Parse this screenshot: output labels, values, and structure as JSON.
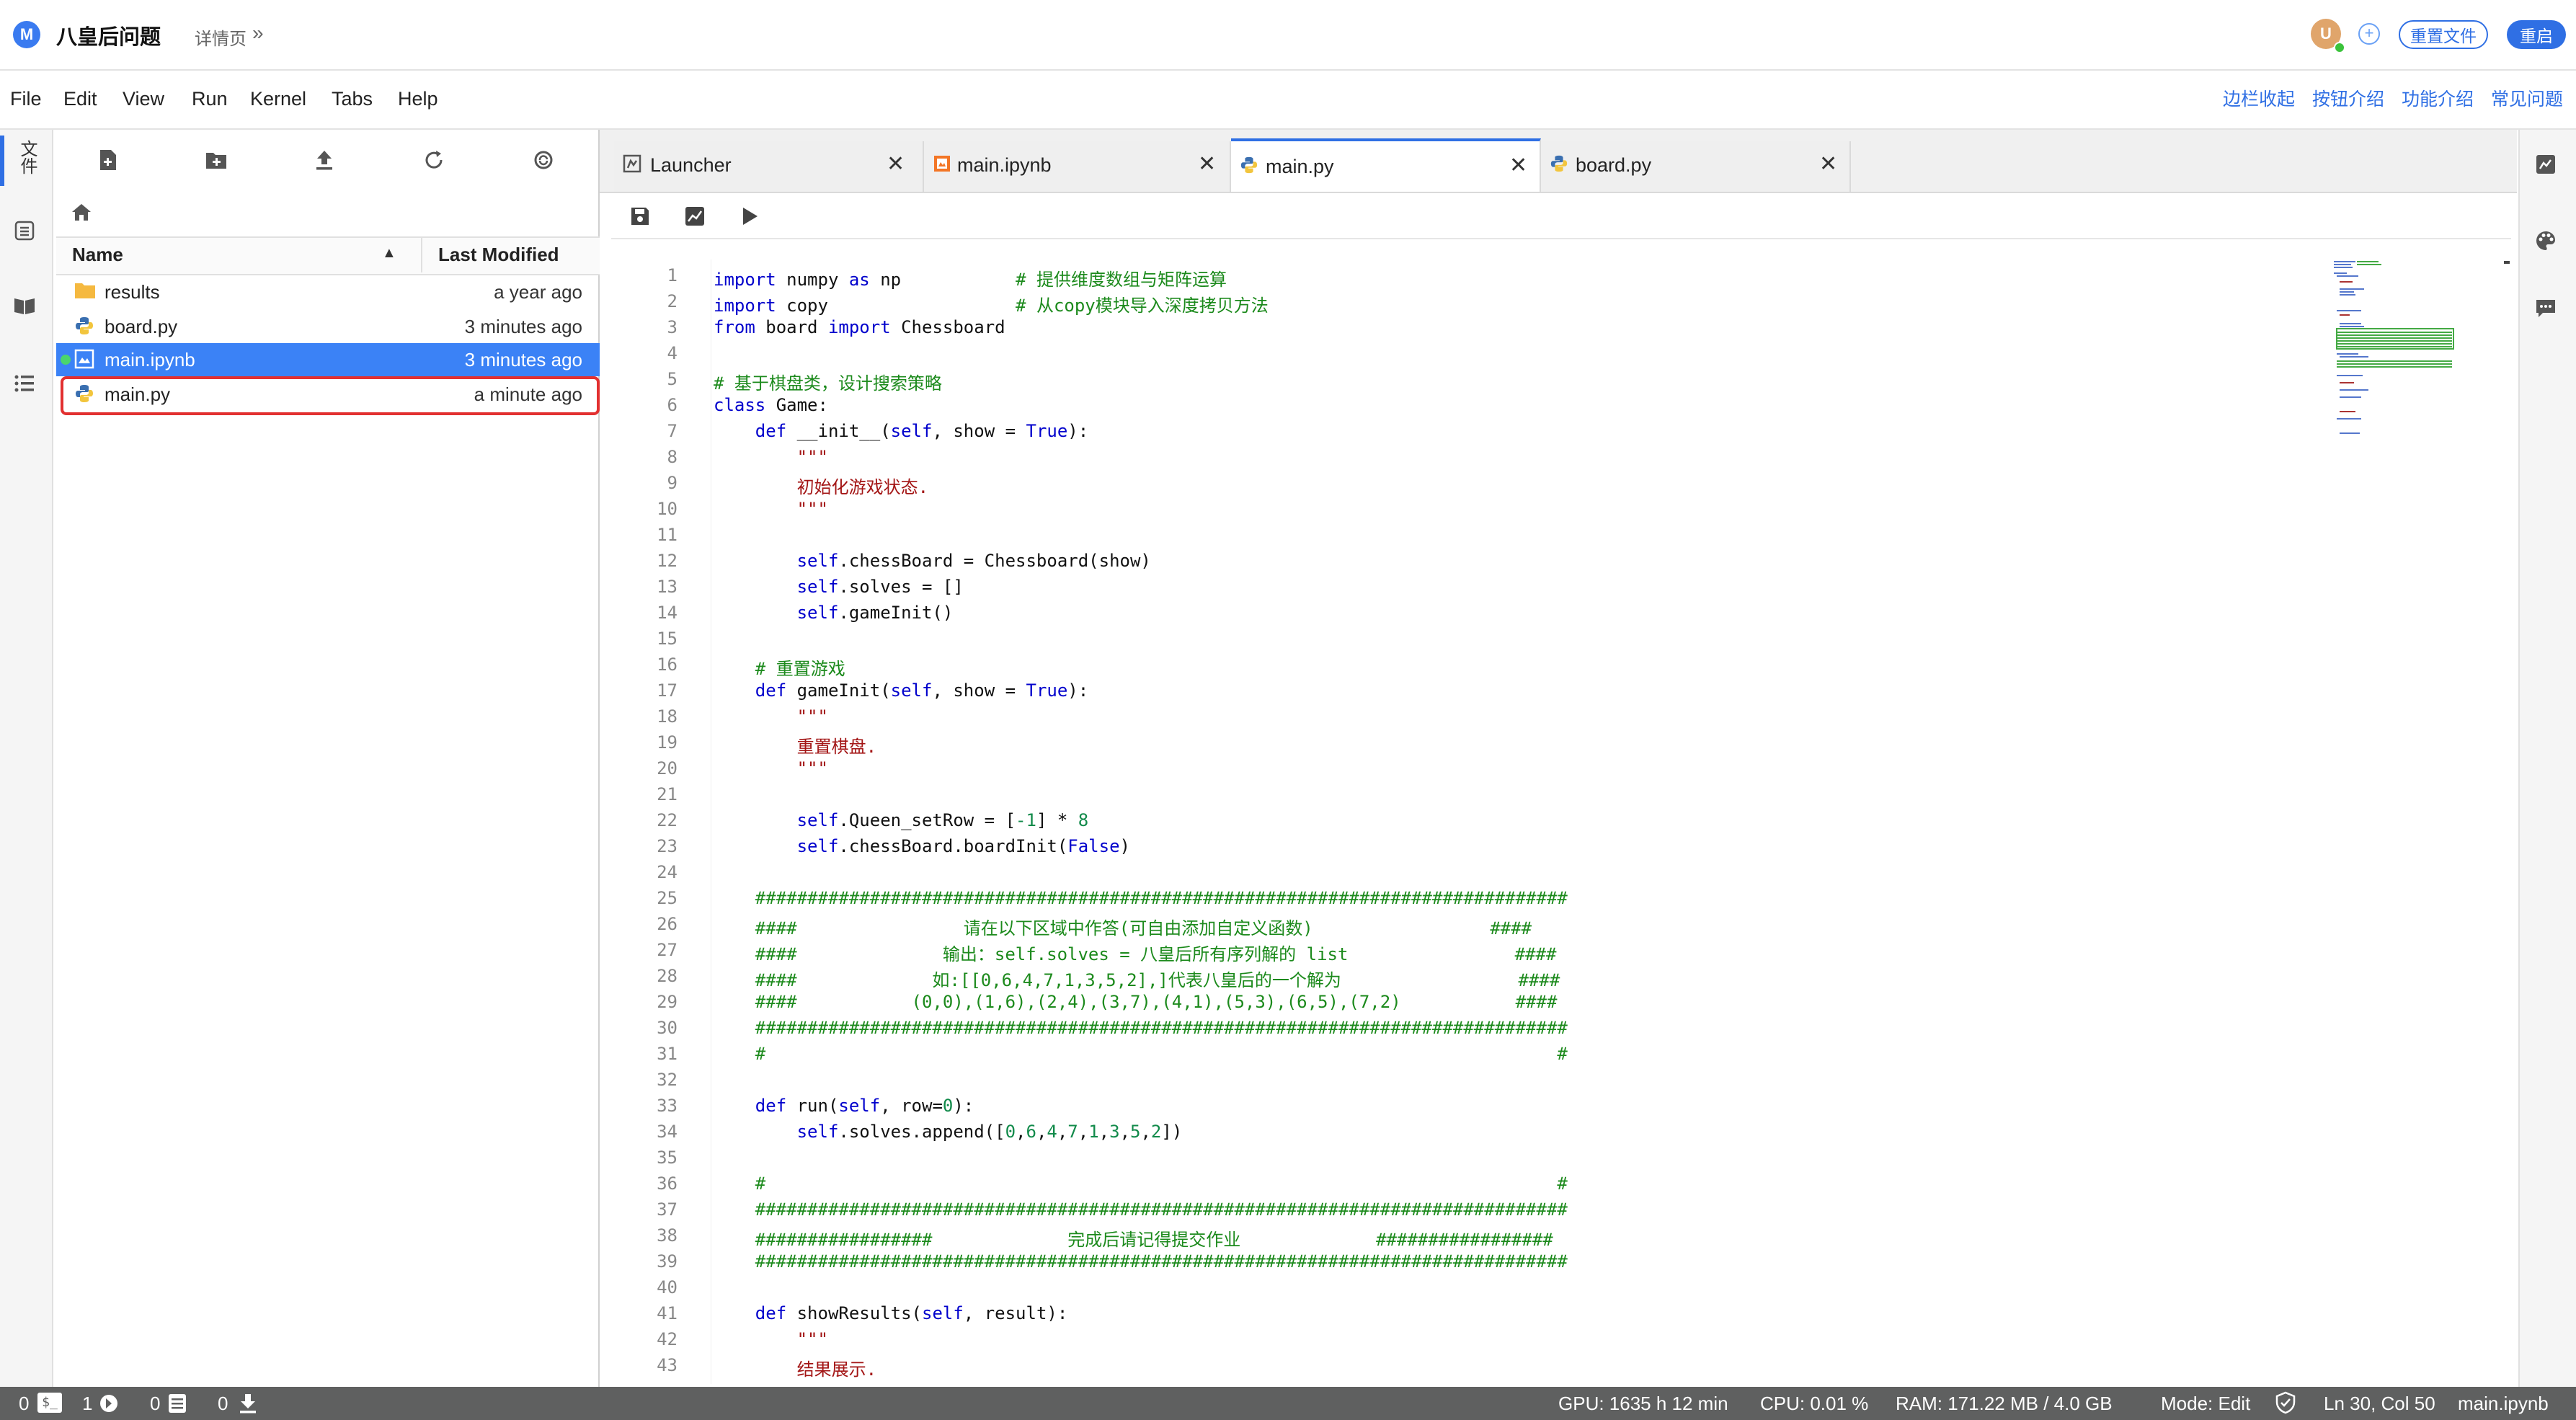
{
  "app": {
    "logo_letter": "M",
    "title": "八皇后问题",
    "breadcrumb": "详情页",
    "breadcrumb_chevron": "»",
    "avatar_letter": "U",
    "reset_button": "重置文件",
    "restart_button": "重启"
  },
  "menu": {
    "items": [
      "File",
      "Edit",
      "View",
      "Run",
      "Kernel",
      "Tabs",
      "Help"
    ],
    "right_links": [
      "边栏收起",
      "按钮介绍",
      "功能介绍",
      "常见问题"
    ]
  },
  "left_strip": {
    "items": [
      {
        "label": "文件",
        "icon": "folder-icon"
      },
      {
        "label": "",
        "icon": "running-icon"
      },
      {
        "label": "",
        "icon": "book-icon"
      },
      {
        "label": "",
        "icon": "toc-icon"
      }
    ]
  },
  "file_browser": {
    "columns": {
      "name": "Name",
      "modified": "Last Modified"
    },
    "rows": [
      {
        "name": "results",
        "modified": "a year ago",
        "type": "folder"
      },
      {
        "name": "board.py",
        "modified": "3 minutes ago",
        "type": "python"
      },
      {
        "name": "main.ipynb",
        "modified": "3 minutes ago",
        "type": "notebook",
        "selected": true,
        "running": true
      },
      {
        "name": "main.py",
        "modified": "a minute ago",
        "type": "python",
        "highlighted": true
      }
    ]
  },
  "tabs": [
    {
      "label": "Launcher",
      "icon": "launcher-icon",
      "active": false
    },
    {
      "label": "main.ipynb",
      "icon": "notebook-icon",
      "active": false
    },
    {
      "label": "main.py",
      "icon": "python-icon",
      "active": true
    },
    {
      "label": "board.py",
      "icon": "python-icon",
      "active": false
    }
  ],
  "code_lines": [
    "import numpy as np           # 提供维度数组与矩阵运算",
    "import copy                  # 从copy模块导入深度拷贝方法",
    "from board import Chessboard",
    "",
    "# 基于棋盘类，设计搜索策略",
    "class Game:",
    "    def __init__(self, show = True):",
    "        \"\"\"",
    "        初始化游戏状态.",
    "        \"\"\"",
    "",
    "        self.chessBoard = Chessboard(show)",
    "        self.solves = []",
    "        self.gameInit()",
    "",
    "    # 重置游戏",
    "    def gameInit(self, show = True):",
    "        \"\"\"",
    "        重置棋盘.",
    "        \"\"\"",
    "",
    "        self.Queen_setRow = [-1] * 8",
    "        self.chessBoard.boardInit(False)",
    "",
    "    ##############################################################################",
    "    ####                请在以下区域中作答(可自由添加自定义函数)                 ####",
    "    ####              输出：self.solves = 八皇后所有序列解的 list                ####",
    "    ####             如:[[0,6,4,7,1,3,5,2],]代表八皇后的一个解为                 ####",
    "    ####           (0,0),(1,6),(2,4),(3,7),(4,1),(5,3),(6,5),(7,2)           ####",
    "    ##############################################################################",
    "    #                                                                            #",
    "",
    "    def run(self, row=0):",
    "        self.solves.append([0,6,4,7,1,3,5,2])",
    "",
    "    #                                                                            #",
    "    ##############################################################################",
    "    #################             完成后请记得提交作业             #################",
    "    ##############################################################################",
    "",
    "    def showResults(self, result):",
    "        \"\"\"",
    "        结果展示."
  ],
  "status": {
    "terminals": "0",
    "kernels": "1",
    "docs": "0",
    "downloads": "0",
    "gpu": "GPU: 1635 h 12 min",
    "cpu": "CPU: 0.01 %",
    "ram": "RAM: 171.22 MB / 4.0 GB",
    "mode": "Mode: Edit",
    "position": "Ln 30, Col 50",
    "file": "main.ipynb"
  },
  "colors": {
    "accent": "#2f6fe4",
    "selection": "#3b82f6",
    "highlight_border": "#e23030",
    "statusbar": "#5f6060"
  }
}
